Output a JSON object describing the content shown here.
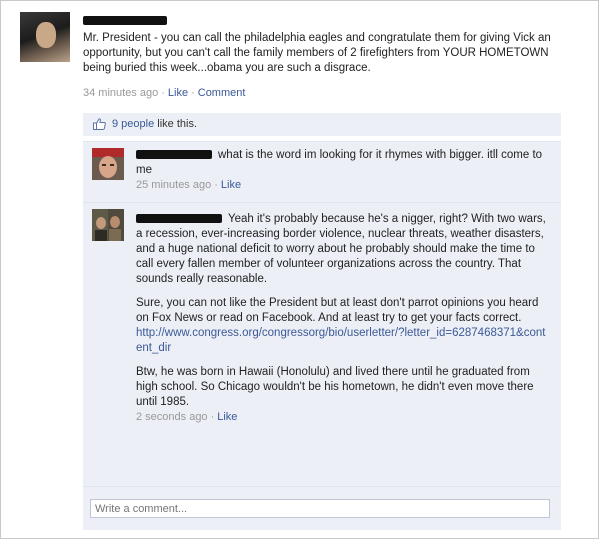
{
  "story": {
    "text": "Mr. President - you can call the philadelphia eagles and congratulate them for giving Vick an opportunity, but you can't call the family members of 2 firefighters from YOUR HOMETOWN being buried this week...obama you are such a disgrace.",
    "timestamp": "34 minutes ago",
    "like_label": "Like",
    "comment_label": "Comment"
  },
  "likes": {
    "count_label": "9 people",
    "suffix": "like this."
  },
  "comments": [
    {
      "text": "what is the word im looking for it rhymes with bigger. itll come to me",
      "timestamp": "25 minutes ago",
      "like_label": "Like"
    },
    {
      "paragraph1": "Yeah it's probably because he's a nigger, right? With two wars, a recession, ever-increasing border violence, nuclear threats, weather disasters, and a huge national deficit to worry about he probably should make the time to call every fallen member of volunteer organizations across the country. That sounds really reasonable.",
      "paragraph2": "Sure, you can not like the President but at least don't parrot opinions you heard on Fox News or read on Facebook. And at least try to get your facts correct.",
      "link": "http://www.congress.org/congressorg/bio/userletter/?letter_id=6287468371&content_dir",
      "paragraph3": "Btw, he was born in Hawaii (Honolulu) and lived there until he graduated from high school. So Chicago wouldn't be his hometown, he didn't even move there until 1985.",
      "timestamp": "2 seconds ago",
      "like_label": "Like"
    }
  ],
  "composer": {
    "placeholder": "Write a comment..."
  },
  "colors": {
    "link": "#3b5998",
    "ufi_background": "#eceff5",
    "muted_text": "#999999"
  }
}
